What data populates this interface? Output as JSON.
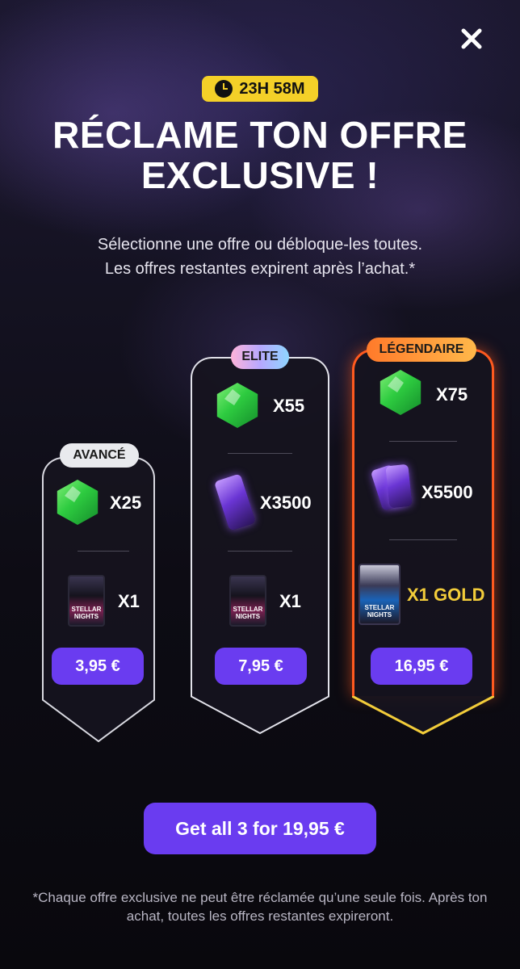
{
  "header": {
    "timer": "23H 58M",
    "title_line1": "RÉCLAME TON OFFRE",
    "title_line2": "EXCLUSIVE !",
    "subtitle_line1": "Sélectionne une offre ou débloque-les toutes.",
    "subtitle_line2": "Les offres restantes expirent après l’achat.*"
  },
  "offers": [
    {
      "tag": "AVANCÉ",
      "items": [
        {
          "icon": "green-gem-icon",
          "qty": "X25"
        },
        {
          "icon": "player-card-pack-icon",
          "qty": "X1",
          "pack_text": "STELLAR NIGHTS"
        }
      ],
      "price": "3,95 €"
    },
    {
      "tag": "ELITE",
      "items": [
        {
          "icon": "green-gem-icon",
          "qty": "X55"
        },
        {
          "icon": "purple-ticket-icon",
          "qty": "X3500"
        },
        {
          "icon": "player-card-pack-icon",
          "qty": "X1",
          "pack_text": "STELLAR NIGHTS"
        }
      ],
      "price": "7,95 €"
    },
    {
      "tag": "LÉGENDAIRE",
      "items": [
        {
          "icon": "green-gem-icon",
          "qty": "X75"
        },
        {
          "icon": "purple-tickets-icon",
          "qty": "X5500"
        },
        {
          "icon": "gold-card-pack-icon",
          "qty": "X1 GOLD",
          "pack_text": "STELLAR NIGHTS"
        }
      ],
      "price": "16,95 €"
    }
  ],
  "bundle": {
    "label": "Get all 3 for 19,95 €"
  },
  "footnote": "*Chaque offre exclusive ne peut être réclamée qu’une seule fois. Après ton achat, toutes les offres restantes expireront.",
  "colors": {
    "accent_purple": "#6a3cf0",
    "timer_yellow": "#f4d028",
    "legendary_orange": "#ff5a1f",
    "gold_text": "#f2cc3a",
    "gem_green": "#2ecc40"
  }
}
